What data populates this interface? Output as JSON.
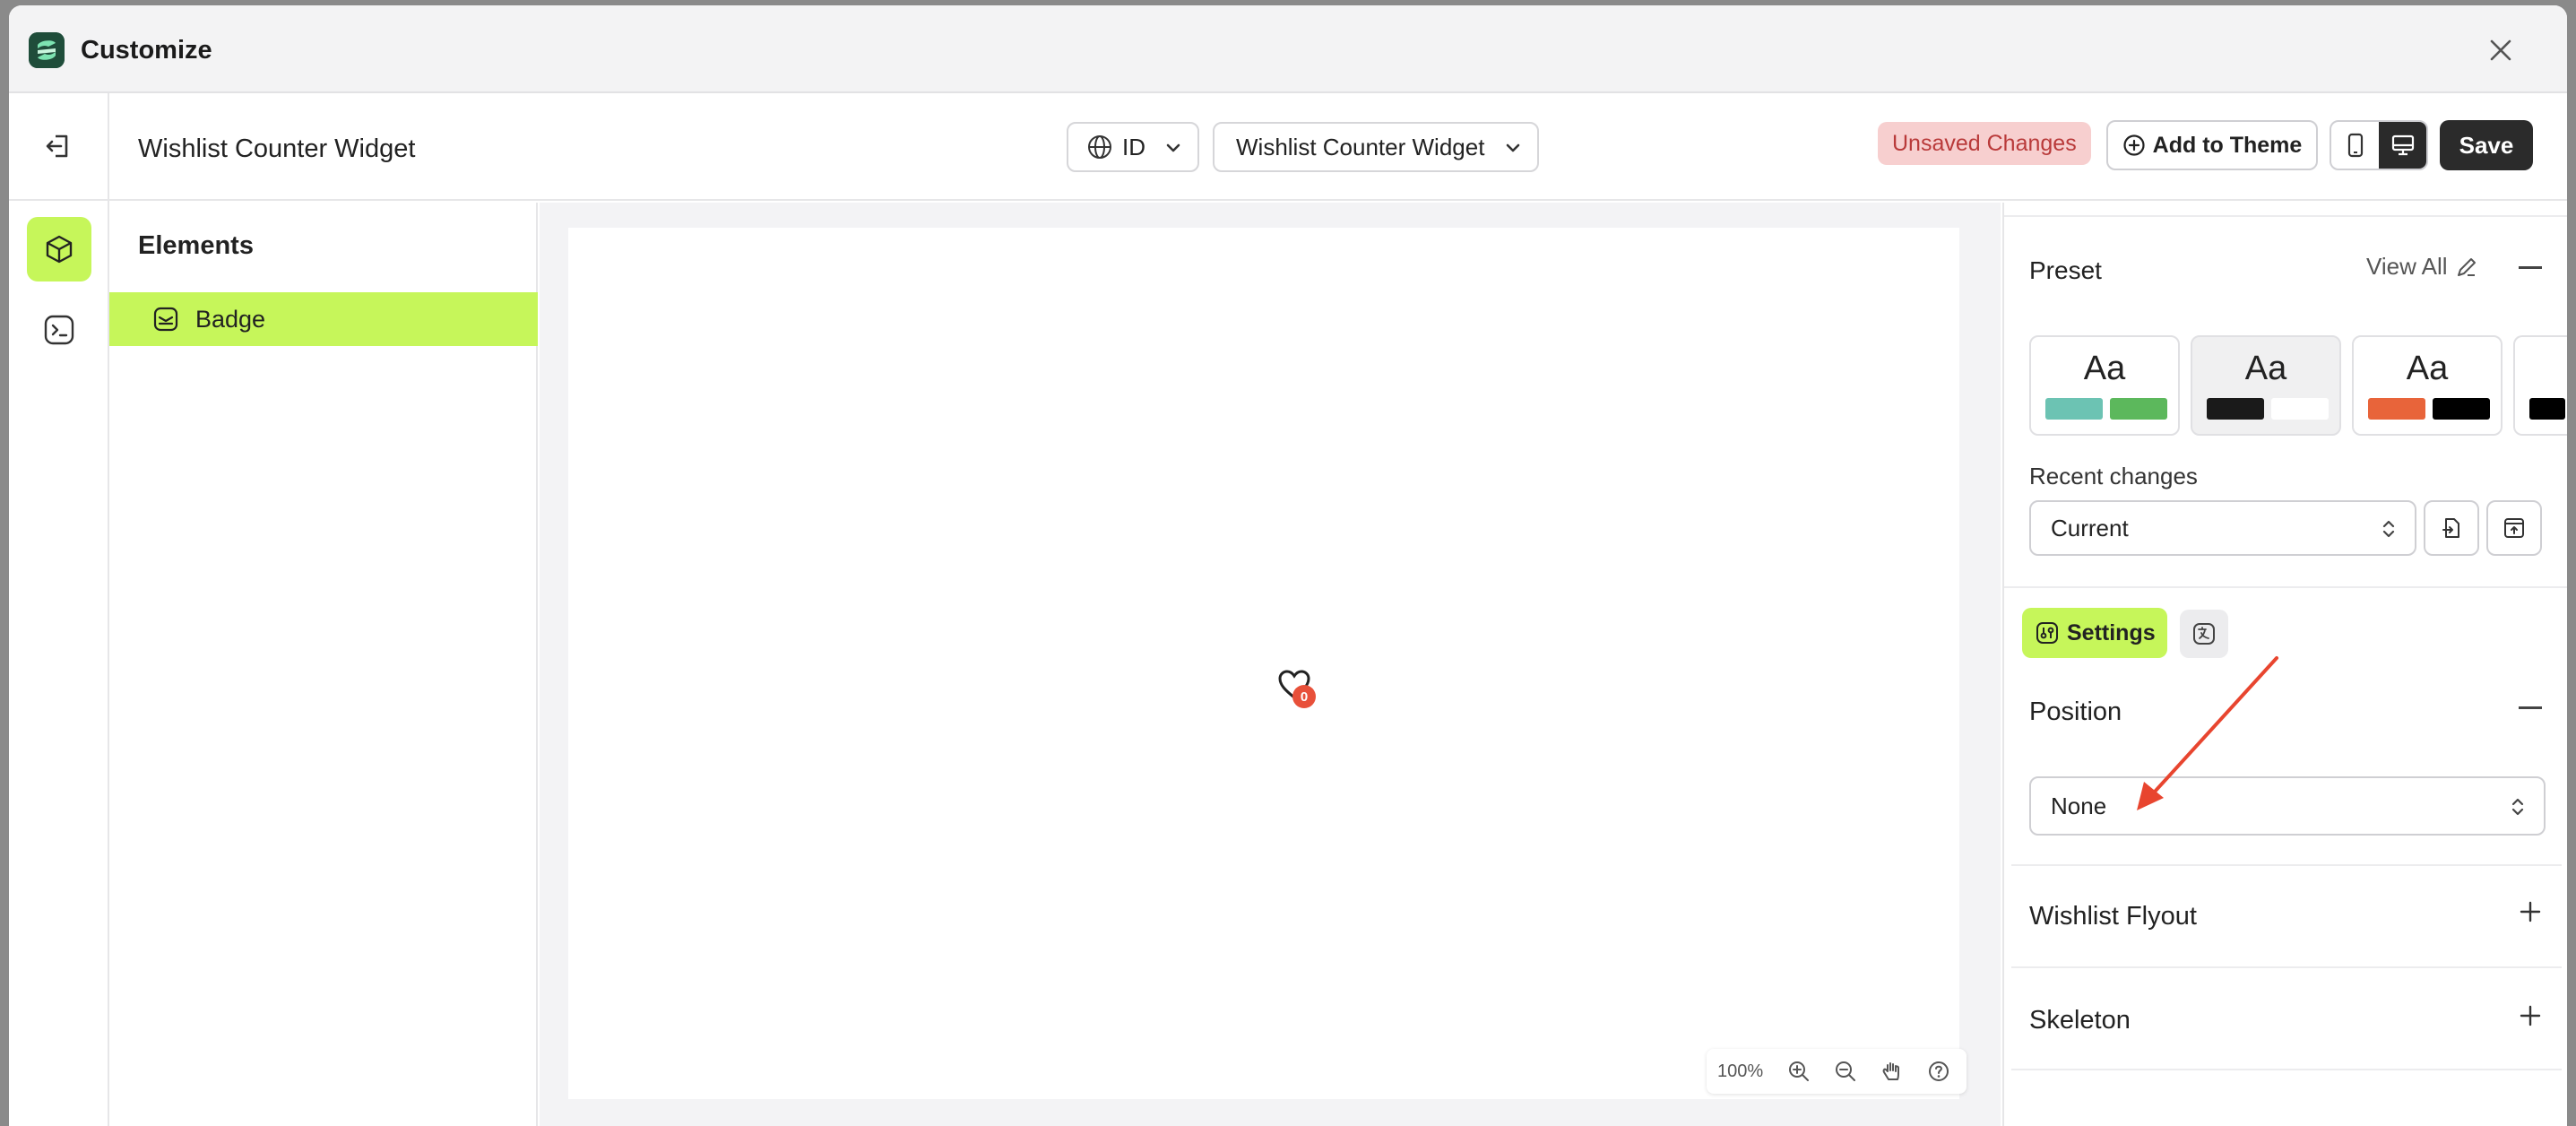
{
  "window": {
    "title": "Customize"
  },
  "header": {
    "title": "Wishlist Counter Widget",
    "language": "ID",
    "widget_selector": "Wishlist Counter Widget",
    "status_badge": "Unsaved Changes",
    "add_to_theme": "Add to Theme",
    "save": "Save"
  },
  "elements_panel": {
    "title": "Elements",
    "items": [
      {
        "label": "Badge",
        "selected": true
      }
    ]
  },
  "canvas": {
    "wishlist_count": "0",
    "zoom_level": "100%"
  },
  "right_panel": {
    "preset": {
      "title": "Preset",
      "view_all": "View All",
      "cards": [
        {
          "label": "Aa",
          "colors": [
            "#6cc3b3",
            "#5cb85c"
          ]
        },
        {
          "label": "Aa",
          "colors": [
            "#1a1a1a",
            "#ffffff"
          ]
        },
        {
          "label": "Aa",
          "colors": [
            "#e8643a",
            "#000000"
          ]
        }
      ]
    },
    "recent_changes": {
      "label": "Recent changes",
      "value": "Current"
    },
    "tabs": {
      "settings": "Settings"
    },
    "position": {
      "title": "Position",
      "value": "None"
    },
    "accordions": [
      {
        "title": "Wishlist Flyout"
      },
      {
        "title": "Skeleton"
      }
    ]
  },
  "colors": {
    "accent": "#c6f65a",
    "unsaved_bg": "#f7cfcf",
    "unsaved_text": "#b93a3a",
    "save_bg": "#2b2b2b",
    "badge_red": "#e8503a",
    "annotation_arrow": "#e8452f"
  }
}
